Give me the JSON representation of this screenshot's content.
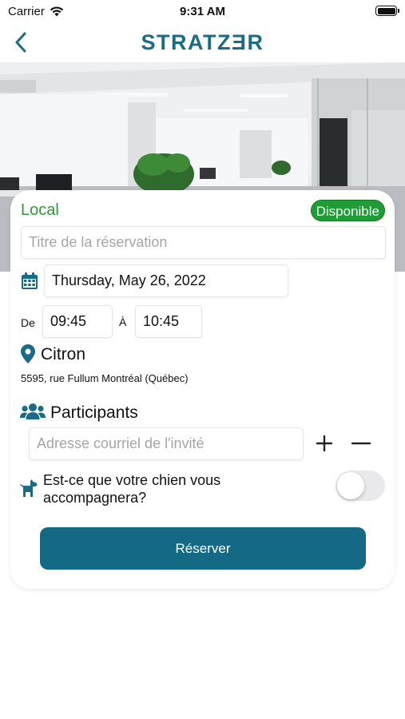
{
  "status_bar": {
    "carrier": "Carrier",
    "time": "9:31 AM"
  },
  "nav": {
    "brand": "STRATZƎR"
  },
  "form": {
    "title": "Local",
    "availability": "Disponible",
    "title_placeholder": "Titre de la réservation",
    "date": "Thursday, May 26, 2022",
    "from_label": "De",
    "from_time": "09:45",
    "to_label": "À",
    "to_time": "10:45",
    "place_name": "Citron",
    "address": "5595, rue Fullum Montréal  (Québec)",
    "participants_label": "Participants",
    "email_placeholder": "Adresse courriel de l'invité",
    "dog_question": "Est-ce que votre chien vous accompagnera?",
    "dog_toggle_on": false,
    "submit_label": "Réserver"
  },
  "colors": {
    "brand": "#1a6c85",
    "available_badge": "#1f9c35",
    "title_green": "#2e9a3a",
    "button": "#146a84"
  },
  "icons": [
    "wifi-icon",
    "battery-icon",
    "back-arrow-icon",
    "calendar-icon",
    "location-pin-icon",
    "people-icon",
    "plus-icon",
    "minus-icon",
    "dog-icon"
  ]
}
